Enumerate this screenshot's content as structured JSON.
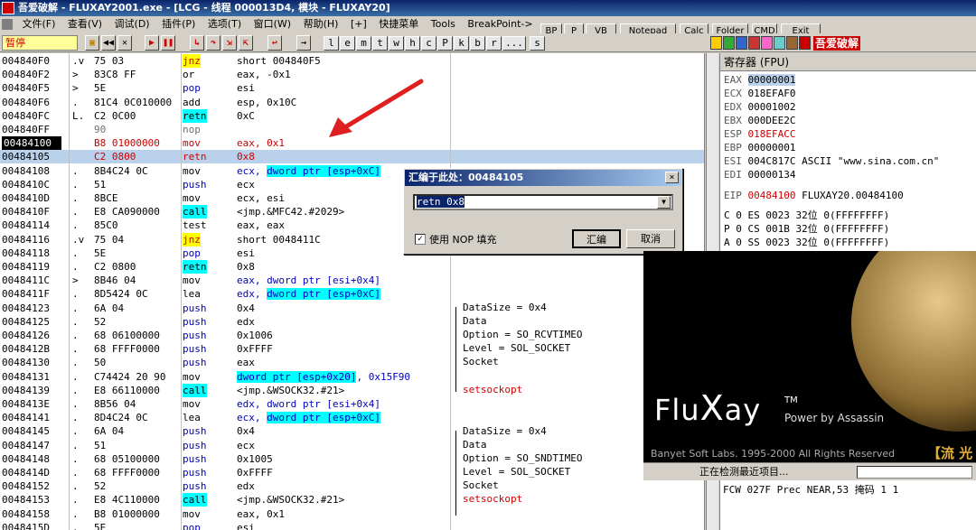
{
  "window": {
    "title": "吾爱破解 - FLUXAY2001.exe - [LCG - 线程 000013D4, 模块 - FLUXAY20]"
  },
  "menu": [
    "文件(F)",
    "查看(V)",
    "调试(D)",
    "插件(P)",
    "选项(T)",
    "窗口(W)",
    "帮助(H)",
    "[+]",
    "快捷菜单",
    "Tools",
    "BreakPoint->"
  ],
  "top_buttons": [
    "BP",
    "P",
    "VB",
    "Notepad",
    "Calc",
    "Folder",
    "CMD",
    "Exit"
  ],
  "toolbar": {
    "status": "暂停",
    "letters": [
      "l",
      "e",
      "m",
      "t",
      "w",
      "h",
      "c",
      "P",
      "k",
      "b",
      "r",
      "...",
      "s"
    ],
    "right_label": "吾爱破解"
  },
  "disasm": [
    {
      "addr": "004840F0",
      "mark": ".v",
      "hex": "75 03",
      "mnem": "jnz",
      "ops": "short 004840F5",
      "mnem_hl": "y"
    },
    {
      "addr": "004840F2",
      "mark": ">",
      "hex": "83C8 FF",
      "mnem": "or",
      "ops": "eax, -0x1"
    },
    {
      "addr": "004840F5",
      "mark": ">",
      "hex": "5E",
      "mnem": "pop",
      "ops": "esi",
      "mnem_blue": true
    },
    {
      "addr": "004840F6",
      "mark": ".",
      "hex": "81C4 0C010000",
      "mnem": "add",
      "ops": "esp, 0x10C"
    },
    {
      "addr": "004840FC",
      "mark": "L.",
      "hex": "C2 0C00",
      "mnem": "retn",
      "ops": "0xC",
      "mnem_hl": "c"
    },
    {
      "addr": "004840FF",
      "mark": "",
      "hex": "90",
      "mnem": "nop",
      "ops": "",
      "dim": true
    },
    {
      "addr": "00484100",
      "mark": "",
      "hex": "B8 01000000",
      "mnem": "mov",
      "ops": "eax, 0x1",
      "red": true,
      "addr_dark": true
    },
    {
      "addr": "00484105",
      "mark": "",
      "hex": "C2 0800",
      "mnem": "retn",
      "ops": "0x8",
      "red": true,
      "sel": true
    },
    {
      "addr": "00484108",
      "mark": ".",
      "hex": "8B4C24 0C",
      "mnem": "mov",
      "ops": "ecx, dword ptr [esp+0xC]",
      "ops_hl": true
    },
    {
      "addr": "0048410C",
      "mark": ".",
      "hex": "51",
      "mnem": "push",
      "ops": "ecx",
      "mnem_blue": true
    },
    {
      "addr": "0048410D",
      "mark": ".",
      "hex": "8BCE",
      "mnem": "mov",
      "ops": "ecx, esi"
    },
    {
      "addr": "0048410F",
      "mark": ".",
      "hex": "E8 CA090000",
      "mnem": "call",
      "ops": "<jmp.&MFC42.#2029>",
      "mnem_hl": "c"
    },
    {
      "addr": "00484114",
      "mark": ".",
      "hex": "85C0",
      "mnem": "test",
      "ops": "eax, eax"
    },
    {
      "addr": "00484116",
      "mark": ".v",
      "hex": "75 04",
      "mnem": "jnz",
      "ops": "short 0048411C",
      "mnem_hl": "y"
    },
    {
      "addr": "00484118",
      "mark": ".",
      "hex": "5E",
      "mnem": "pop",
      "ops": "esi",
      "mnem_blue": true
    },
    {
      "addr": "00484119",
      "mark": ".",
      "hex": "C2 0800",
      "mnem": "retn",
      "ops": "0x8",
      "mnem_hl": "c"
    },
    {
      "addr": "0048411C",
      "mark": ">",
      "hex": "8B46 04",
      "mnem": "mov",
      "ops": "eax, dword ptr [esi+0x4]",
      "ops_blue": true
    },
    {
      "addr": "0048411F",
      "mark": ".",
      "hex": "8D5424 0C",
      "mnem": "lea",
      "ops": "edx, dword ptr [esp+0xC]",
      "ops_hl": true
    },
    {
      "addr": "00484123",
      "mark": ".",
      "hex": "6A 04",
      "mnem": "push",
      "ops": "0x4",
      "mnem_blue": true
    },
    {
      "addr": "00484125",
      "mark": ".",
      "hex": "52",
      "mnem": "push",
      "ops": "edx",
      "mnem_blue": true
    },
    {
      "addr": "00484126",
      "mark": ".",
      "hex": "68 06100000",
      "mnem": "push",
      "ops": "0x1006",
      "mnem_blue": true
    },
    {
      "addr": "0048412B",
      "mark": ".",
      "hex": "68 FFFF0000",
      "mnem": "push",
      "ops": "0xFFFF",
      "mnem_blue": true
    },
    {
      "addr": "00484130",
      "mark": ".",
      "hex": "50",
      "mnem": "push",
      "ops": "eax",
      "mnem_blue": true
    },
    {
      "addr": "00484131",
      "mark": ".",
      "hex": "C74424 20 90",
      "mnem": "mov",
      "ops": "dword ptr [esp+0x20], 0x15F90",
      "ops_hl": true
    },
    {
      "addr": "00484139",
      "mark": ".",
      "hex": "E8 66110000",
      "mnem": "call",
      "ops": "<jmp.&WSOCK32.#21>",
      "mnem_hl": "c"
    },
    {
      "addr": "0048413E",
      "mark": ".",
      "hex": "8B56 04",
      "mnem": "mov",
      "ops": "edx, dword ptr [esi+0x4]",
      "ops_blue": true
    },
    {
      "addr": "00484141",
      "mark": ".",
      "hex": "8D4C24 0C",
      "mnem": "lea",
      "ops": "ecx, dword ptr [esp+0xC]",
      "ops_hl": true
    },
    {
      "addr": "00484145",
      "mark": ".",
      "hex": "6A 04",
      "mnem": "push",
      "ops": "0x4",
      "mnem_blue": true
    },
    {
      "addr": "00484147",
      "mark": ".",
      "hex": "51",
      "mnem": "push",
      "ops": "ecx",
      "mnem_blue": true
    },
    {
      "addr": "00484148",
      "mark": ".",
      "hex": "68 05100000",
      "mnem": "push",
      "ops": "0x1005",
      "mnem_blue": true
    },
    {
      "addr": "0048414D",
      "mark": ".",
      "hex": "68 FFFF0000",
      "mnem": "push",
      "ops": "0xFFFF",
      "mnem_blue": true
    },
    {
      "addr": "00484152",
      "mark": ".",
      "hex": "52",
      "mnem": "push",
      "ops": "edx",
      "mnem_blue": true
    },
    {
      "addr": "00484153",
      "mark": ".",
      "hex": "E8 4C110000",
      "mnem": "call",
      "ops": "<jmp.&WSOCK32.#21>",
      "mnem_hl": "c"
    },
    {
      "addr": "00484158",
      "mark": ".",
      "hex": "B8 01000000",
      "mnem": "mov",
      "ops": "eax, 0x1"
    },
    {
      "addr": "0048415D",
      "mark": ".",
      "hex": "5E",
      "mnem": "pop",
      "ops": "esi",
      "mnem_blue": true
    }
  ],
  "comments": {
    "block1": [
      "DataSize = 0x4",
      "Data",
      "Option = SO_RCVTIMEO",
      "Level = SOL_SOCKET",
      "Socket",
      "setsockopt"
    ],
    "block2": [
      "DataSize = 0x4",
      "Data",
      "Option = SO_SNDTIMEO",
      "Level = SOL_SOCKET",
      "Socket",
      "setsockopt"
    ]
  },
  "registers": {
    "title": "寄存器 (FPU)",
    "gpr": [
      {
        "name": "EAX",
        "value": "00000001",
        "selected": true
      },
      {
        "name": "ECX",
        "value": "018EFAF0"
      },
      {
        "name": "EDX",
        "value": "00001002"
      },
      {
        "name": "EBX",
        "value": "000DEE2C"
      },
      {
        "name": "ESP",
        "value": "018EFACC",
        "red": true
      },
      {
        "name": "EBP",
        "value": "00000001"
      },
      {
        "name": "ESI",
        "value": "004C817C ASCII \"www.sina.com.cn\""
      },
      {
        "name": "EDI",
        "value": "00000134"
      }
    ],
    "eip": {
      "name": "EIP",
      "value": "00484100",
      "extra": "FLUXAY20.00484100"
    },
    "flags": [
      {
        "flag": "C 0",
        "seg": "ES 0023",
        "info": "32位 0(FFFFFFFF)"
      },
      {
        "flag": "P 0",
        "seg": "CS 001B",
        "info": "32位 0(FFFFFFFF)"
      },
      {
        "flag": "A 0",
        "seg": "SS 0023",
        "info": "32位 0(FFFFFFFF)"
      }
    ],
    "fpu_line": "FCW 027F  Prec NEAR,53  掩码    1 1"
  },
  "dialog": {
    "title": "汇编于此处：00484105",
    "input_value": "retn 0x8",
    "checkbox_label": "使用 NOP 填充",
    "checkbox_mark": "✓",
    "assemble_label": "汇编",
    "cancel_label": "取消",
    "close_glyph": "×",
    "dropdown_glyph": "▼"
  },
  "splash": {
    "logo_prefix": "Flu",
    "logo_x": "X",
    "logo_suffix": "ay",
    "tm": "TM",
    "power": "Power by Assassin",
    "copyright": "Banyet Soft Labs. 1995-2000 All Rights Reserved",
    "tag": "【流 光",
    "status": "正在检测最近项目..."
  }
}
